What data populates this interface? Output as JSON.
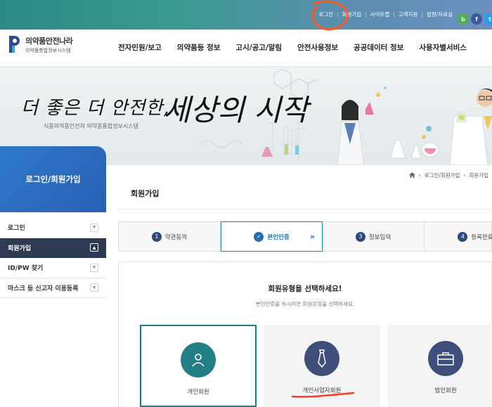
{
  "top_links": [
    "로그인",
    "회원가입",
    "사이트맵",
    "고객지원",
    "법령/자료실"
  ],
  "social": [
    {
      "letter": "b",
      "color": "#4caf50"
    },
    {
      "letter": "f",
      "color": "#3b5998"
    },
    {
      "letter": "t",
      "color": "#1da1f2"
    }
  ],
  "logo": {
    "title": "의약품안전나라",
    "subtitle": "의약품통합정보시스템"
  },
  "nav": [
    "전자민원/보고",
    "의약품등 정보",
    "고시/공고/알림",
    "안전사용정보",
    "공공데이터 정보",
    "사용자별서비스"
  ],
  "hero": {
    "slogan_a": "더 좋은 더 안전한,",
    "slogan_b": "세상의 시작",
    "sub": "식품의약품안전처 의약품통합정보시스템"
  },
  "sidebar": {
    "title": "로그인/회원가입",
    "items": [
      {
        "label": "로그인"
      },
      {
        "label": "회원가입"
      },
      {
        "label": "ID/PW 찾기"
      },
      {
        "label": "마스크 등 신고자 이용등록"
      }
    ]
  },
  "breadcrumb": [
    "로그인/회원가입",
    "회원가입"
  ],
  "page_title": "회원가입",
  "steps": [
    {
      "num": "1",
      "label": "약관동의"
    },
    {
      "num": "",
      "label": "본인인증"
    },
    {
      "num": "3",
      "label": "정보입력"
    },
    {
      "num": "4",
      "label": "등록완료"
    }
  ],
  "question": {
    "title": "회원유형을 선택하세요!",
    "sub": "본인인증을 하시려면 회원유형을 선택하세요."
  },
  "member_types": [
    {
      "label": "개인회원",
      "color": "#237f86"
    },
    {
      "label": "개인사업자회원",
      "color": "#3d4f7a"
    },
    {
      "label": "법인회원",
      "color": "#3d4f7a"
    }
  ],
  "colors": {
    "accent": "#2a6aa6",
    "annotation": "#ff5a1f",
    "teal": "#237f86"
  }
}
